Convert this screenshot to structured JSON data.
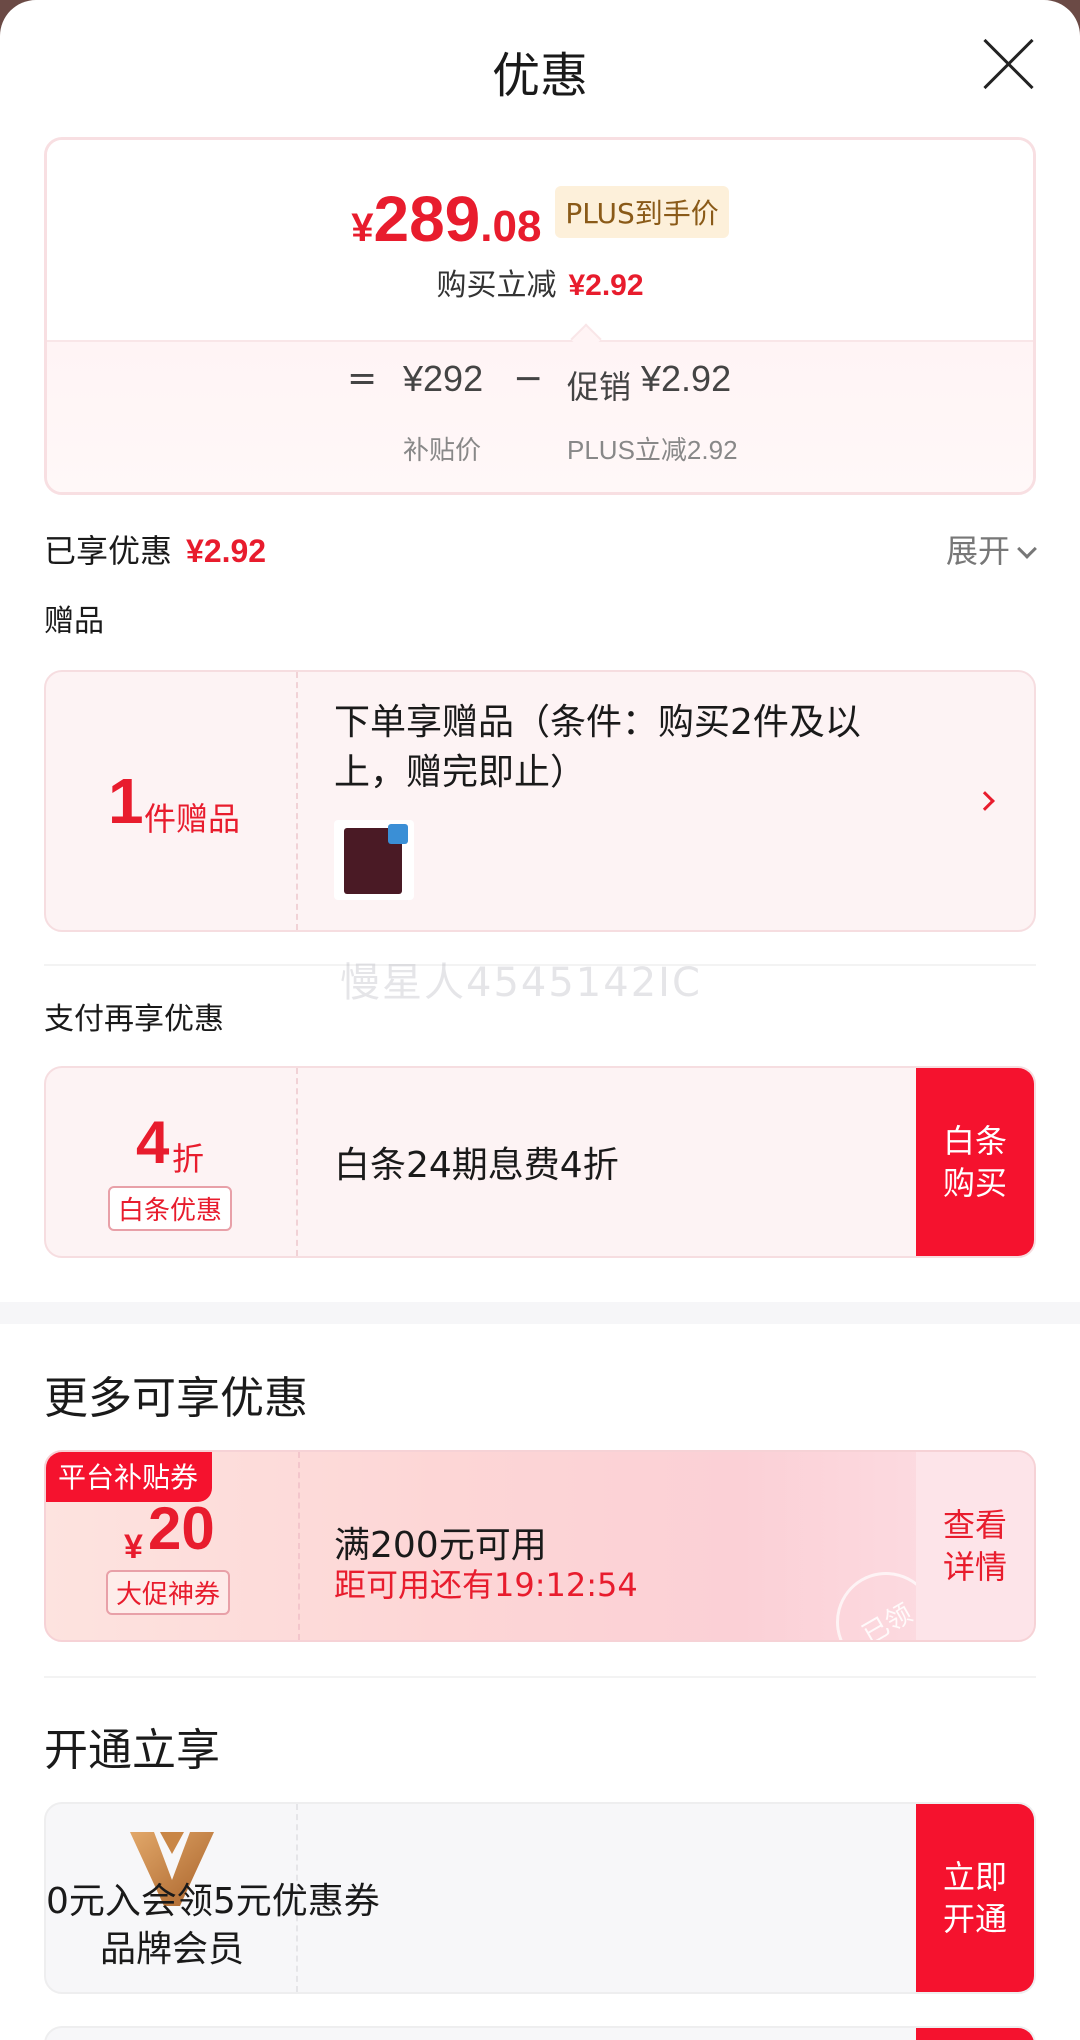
{
  "header": {
    "title": "优惠"
  },
  "price_card": {
    "currency": "¥",
    "price_int": "289",
    "price_dec": ".08",
    "plus_badge": "PLUS到手价",
    "reduce_label": "购买立减",
    "reduce_value": "¥2.92",
    "calc": {
      "eq": "=",
      "subsidy_price": "¥292",
      "minus": "−",
      "promo_label": "促销",
      "promo_value": "¥2.92",
      "subsidy_label": "补贴价",
      "plus_reduce_label": "PLUS立减2.92"
    }
  },
  "enjoyed": {
    "label": "已享优惠",
    "value": "¥2.92",
    "expand_label": "展开"
  },
  "gift_section": {
    "title": "赠品",
    "num": "1",
    "unit": "件赠品",
    "desc": "下单享赠品（条件：购买2件及以上，赠完即止）",
    "thumb_icon": "gift-bag-icon"
  },
  "watermark": "慢星人4545142IC",
  "pay_section": {
    "title": "支付再享优惠",
    "num": "4",
    "unit": "折",
    "tag": "白条优惠",
    "desc": "白条24期息费4折",
    "button": "白条购买"
  },
  "more_section": {
    "title": "更多可享优惠",
    "coupon": {
      "tag": "平台补贴券",
      "yen": "¥",
      "amount": "20",
      "type": "大促神券",
      "condition": "满200元可用",
      "countdown": "距可用还有19:12:54",
      "view_button": "查看详情",
      "stamp": "已领"
    }
  },
  "open_section": {
    "title": "开通立享",
    "member": {
      "name": "品牌会员",
      "logo_icon": "brand-v-logo-icon",
      "desc": "0元入会领5元优惠券",
      "button": "立即开通"
    }
  },
  "colors": {
    "accent": "#f5122e",
    "price_red": "#e81c2d",
    "plus_gold": "#8a5a18"
  }
}
